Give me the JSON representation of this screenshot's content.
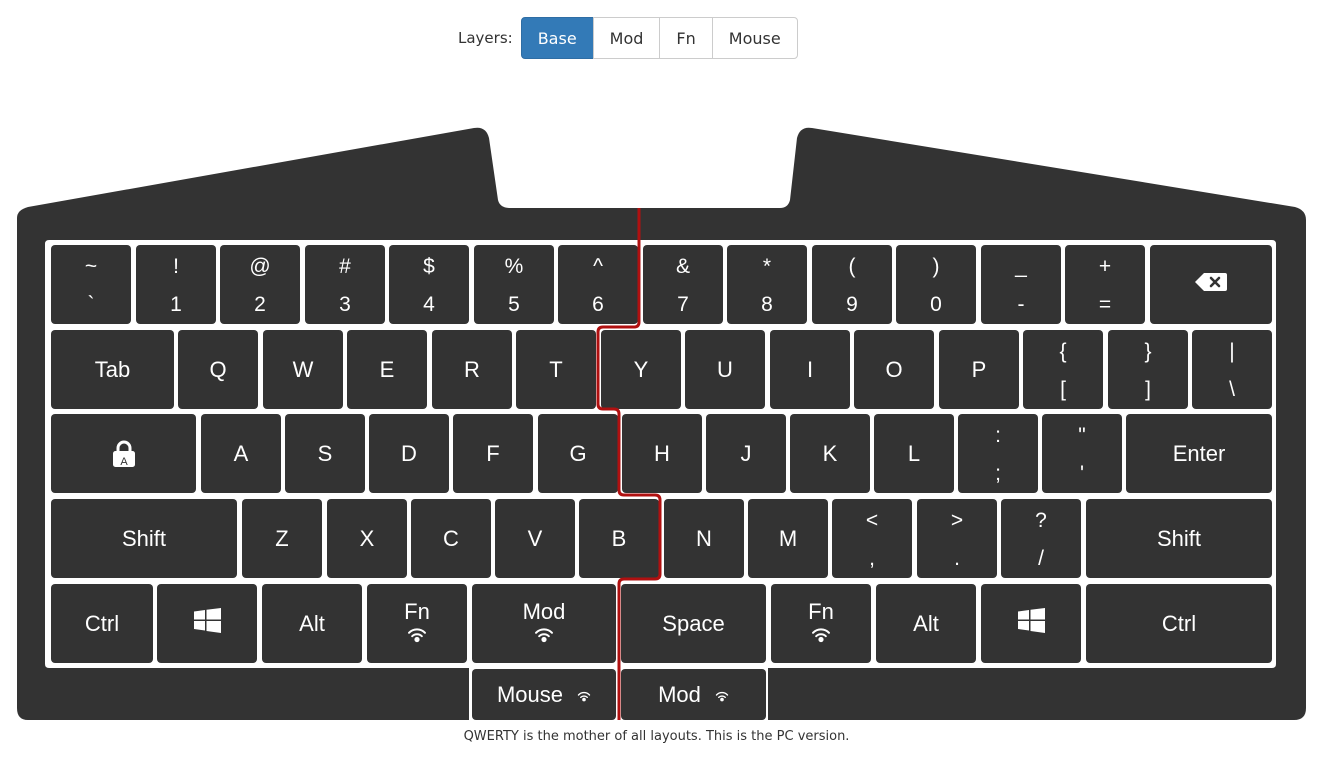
{
  "layers": {
    "label": "Layers:",
    "buttons": [
      {
        "label": "Base",
        "active": true
      },
      {
        "label": "Mod",
        "active": false
      },
      {
        "label": "Fn",
        "active": false
      },
      {
        "label": "Mouse",
        "active": false
      }
    ]
  },
  "keyboard": {
    "colors": {
      "body": "#333333",
      "plate": "#ffffff",
      "key": "#333333",
      "split": "#b01010"
    },
    "rows": [
      [
        {
          "top": "~",
          "bottom": "`"
        },
        {
          "top": "!",
          "bottom": "1"
        },
        {
          "top": "@",
          "bottom": "2"
        },
        {
          "top": "#",
          "bottom": "3"
        },
        {
          "top": "$",
          "bottom": "4"
        },
        {
          "top": "%",
          "bottom": "5"
        },
        {
          "top": "^",
          "bottom": "6"
        },
        {
          "top": "&",
          "bottom": "7"
        },
        {
          "top": "*",
          "bottom": "8"
        },
        {
          "top": "(",
          "bottom": "9"
        },
        {
          "top": ")",
          "bottom": "0"
        },
        {
          "top": "_",
          "bottom": "-"
        },
        {
          "top": "+",
          "bottom": "="
        },
        {
          "icon": "backspace-icon"
        }
      ],
      [
        {
          "label": "Tab"
        },
        {
          "label": "Q"
        },
        {
          "label": "W"
        },
        {
          "label": "E"
        },
        {
          "label": "R"
        },
        {
          "label": "T"
        },
        {
          "label": "Y"
        },
        {
          "label": "U"
        },
        {
          "label": "I"
        },
        {
          "label": "O"
        },
        {
          "label": "P"
        },
        {
          "top": "{",
          "bottom": "["
        },
        {
          "top": "}",
          "bottom": "]"
        },
        {
          "top": "|",
          "bottom": "\\"
        }
      ],
      [
        {
          "icon": "caps-lock-icon",
          "icon_letter": "A"
        },
        {
          "label": "A"
        },
        {
          "label": "S"
        },
        {
          "label": "D"
        },
        {
          "label": "F"
        },
        {
          "label": "G"
        },
        {
          "label": "H"
        },
        {
          "label": "J"
        },
        {
          "label": "K"
        },
        {
          "label": "L"
        },
        {
          "top": ":",
          "bottom": ";"
        },
        {
          "top": "\"",
          "bottom": "'"
        },
        {
          "label": "Enter"
        }
      ],
      [
        {
          "label": "Shift"
        },
        {
          "label": "Z"
        },
        {
          "label": "X"
        },
        {
          "label": "C"
        },
        {
          "label": "V"
        },
        {
          "label": "B"
        },
        {
          "label": "N"
        },
        {
          "label": "M"
        },
        {
          "top": "<",
          "bottom": ","
        },
        {
          "top": ">",
          "bottom": "."
        },
        {
          "top": "?",
          "bottom": "/"
        },
        {
          "label": "Shift"
        }
      ],
      [
        {
          "label": "Ctrl"
        },
        {
          "icon": "windows-icon"
        },
        {
          "label": "Alt"
        },
        {
          "label": "Fn",
          "icon": "wireless-icon"
        },
        {
          "label": "Mod",
          "icon": "wireless-icon"
        },
        {
          "label": "Space"
        },
        {
          "label": "Fn",
          "icon": "wireless-icon"
        },
        {
          "label": "Alt"
        },
        {
          "icon": "windows-icon"
        },
        {
          "label": "Ctrl"
        }
      ],
      [
        {
          "label": "Mouse",
          "icon": "wireless-icon"
        },
        {
          "label": "Mod",
          "icon": "wireless-icon"
        }
      ]
    ]
  },
  "caption": "QWERTY is the mother of all layouts. This is the PC version."
}
